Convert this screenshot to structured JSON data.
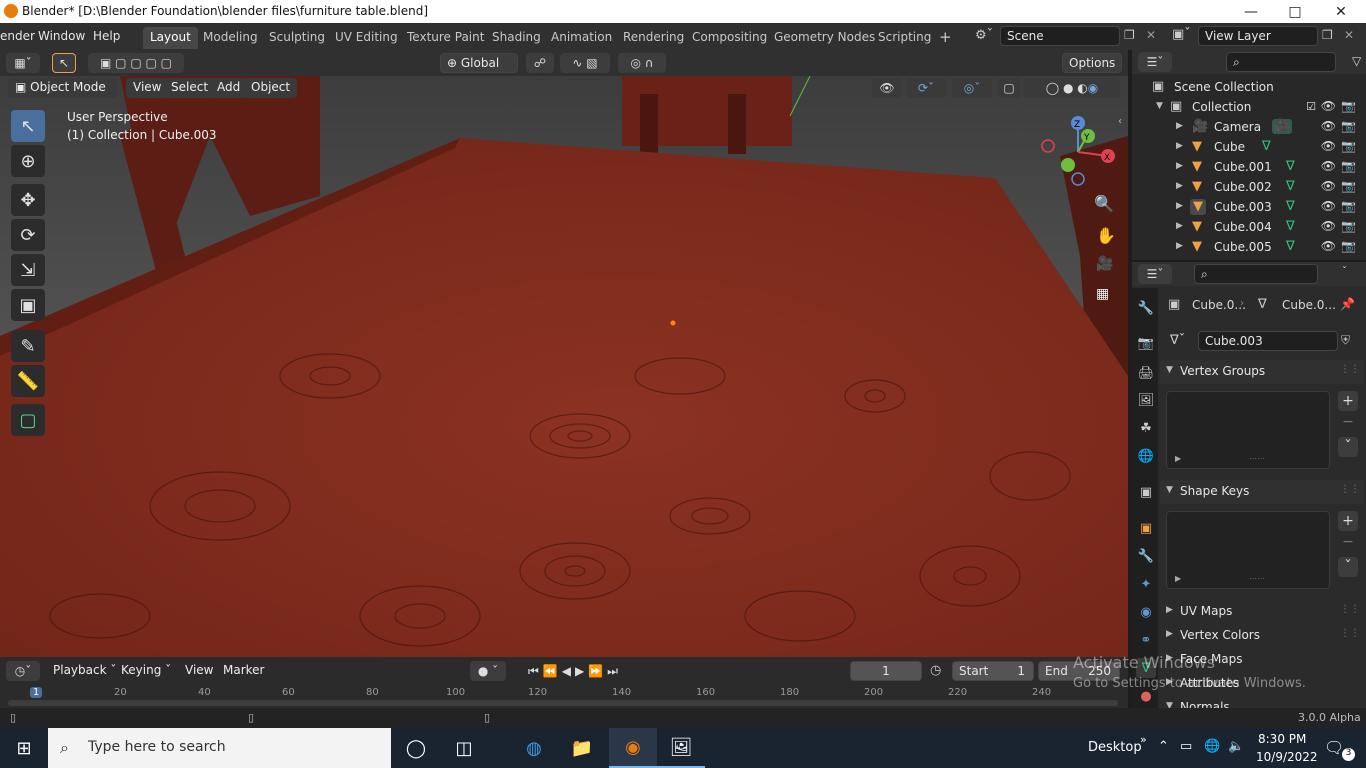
{
  "window": {
    "title": "Blender* [D:\\Blender Foundation\\blender files\\furniture table.blend]",
    "minimize_icon": "minimize-icon",
    "maximize_icon": "maximize-icon",
    "close_icon": "close-icon"
  },
  "menubar": {
    "items": [
      "ender",
      "Window",
      "Help"
    ]
  },
  "workspaces": {
    "tabs": [
      "Layout",
      "Modeling",
      "Sculpting",
      "UV Editing",
      "Texture Paint",
      "Shading",
      "Animation",
      "Rendering",
      "Compositing",
      "Geometry Nodes",
      "Scripting"
    ],
    "active": "Layout",
    "add_label": "+"
  },
  "scene": {
    "name": "Scene",
    "view_layer": "View Layer"
  },
  "viewport_header": {
    "mode": "Object Mode",
    "menus": [
      "View",
      "Select",
      "Add",
      "Object"
    ],
    "transform_orientation": "Global",
    "options_label": "Options"
  },
  "viewport": {
    "perspective_label": "User Perspective",
    "collection_label": "(1) Collection | Cube.003",
    "gizmo_axes": [
      "Z",
      "Y",
      "X"
    ]
  },
  "outliner": {
    "root": "Scene Collection",
    "collection": "Collection",
    "items": [
      {
        "name": "Camera",
        "type": "camera"
      },
      {
        "name": "Cube",
        "type": "mesh"
      },
      {
        "name": "Cube.001",
        "type": "mesh"
      },
      {
        "name": "Cube.002",
        "type": "mesh"
      },
      {
        "name": "Cube.003",
        "type": "mesh"
      },
      {
        "name": "Cube.004",
        "type": "mesh"
      },
      {
        "name": "Cube.005",
        "type": "mesh"
      }
    ]
  },
  "properties": {
    "breadcrumb_object": "Cube.0...",
    "breadcrumb_data": "Cube.0...",
    "mesh_name": "Cube.003",
    "panels": {
      "vertex_groups": "Vertex Groups",
      "shape_keys": "Shape Keys",
      "uv_maps": "UV Maps",
      "vertex_colors": "Vertex Colors",
      "face_maps": "Face Maps",
      "attributes": "Attributes",
      "normals": "Normals"
    }
  },
  "timeline": {
    "menus": [
      "Playback",
      "Keying",
      "View",
      "Marker"
    ],
    "current_frame": "1",
    "start_label": "Start",
    "start_value": "1",
    "end_label": "End",
    "end_value": "250",
    "ruler_ticks": [
      "1",
      "20",
      "40",
      "60",
      "80",
      "100",
      "120",
      "140",
      "160",
      "180",
      "200",
      "220",
      "240"
    ]
  },
  "statusbar": {
    "version": "3.0.0 Alpha"
  },
  "watermark": {
    "line1": "Activate Windows",
    "line2": "Go to Settings to activate Windows."
  },
  "taskbar": {
    "search_placeholder": "Type here to search",
    "desktop_label": "Desktop",
    "time": "8:30 PM",
    "date": "10/9/2022",
    "notification_count": "3"
  },
  "colors": {
    "accent": "#4b6f9c",
    "table_wood": "#8a2e1e",
    "blender_orange": "#e87d0d",
    "mesh_green": "#2ec27e"
  }
}
